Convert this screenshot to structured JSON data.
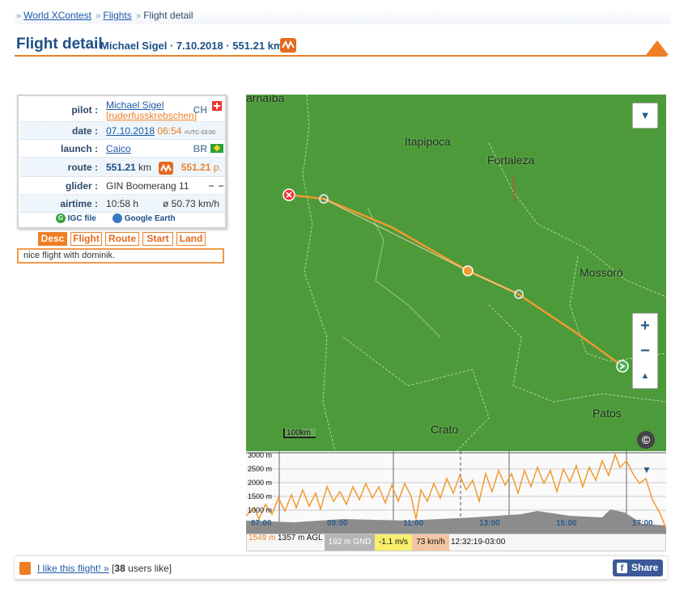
{
  "breadcrumb": {
    "items": [
      "World XContest",
      "Flights"
    ],
    "current": "Flight detail"
  },
  "title": {
    "main": "Flight detail",
    "sub": "Michael Sigel · 7.10.2018 · 551.21 km"
  },
  "info": {
    "pilot_label": "pilot :",
    "pilot_name": "Michael Sigel",
    "pilot_nick": "[ruderfusskrebschen]",
    "pilot_country": "CH",
    "date_label": "date :",
    "date": "07.10.2018",
    "time": "06:54",
    "tz": "=UTC-03:00",
    "launch_label": "launch :",
    "launch": "Caico",
    "launch_country": "BR",
    "route_label": "route :",
    "route_km": "551.21",
    "route_km_unit": "km",
    "route_points": "551.21",
    "route_points_unit": "p.",
    "glider_label": "glider :",
    "glider": "GIN Boomerang 11",
    "airtime_label": "airtime :",
    "airtime": "10:58 h",
    "speed": "ø 50.73 km/h",
    "igc_label": "IGC file",
    "ge_label": "Google Earth"
  },
  "tabs": [
    "Desc",
    "Flight",
    "Route",
    "Start",
    "Land"
  ],
  "active_tab": "Desc",
  "description": "nice flight with dominik.",
  "map": {
    "cities": [
      "arnaíba",
      "Itapipoca",
      "Fortaleza",
      "Mossoró",
      "Patos",
      "Crato"
    ],
    "scale": "100km",
    "zoom_in": "+",
    "zoom_out": "−",
    "track_color": "#f29a2e",
    "land_color": "#4c9a3a"
  },
  "barogram": {
    "alt_labels": [
      "3000 m",
      "2500 m",
      "2000 m",
      "1500 m",
      "1000 m"
    ],
    "time_labels": [
      "07:00",
      "09:00",
      "11:00",
      "13:00",
      "15:00",
      "17:00"
    ]
  },
  "status": {
    "alt_msl": "1549 m",
    "alt_agl": "1357 m AGL",
    "gnd": "192 m GND",
    "vario": "-1.1 m/s",
    "speed": "73 km/h",
    "time": "12:32:19-03:00"
  },
  "like": {
    "link": "I like this flight! »",
    "count": "38",
    "suffix": "users like"
  },
  "share_label": "Share"
}
